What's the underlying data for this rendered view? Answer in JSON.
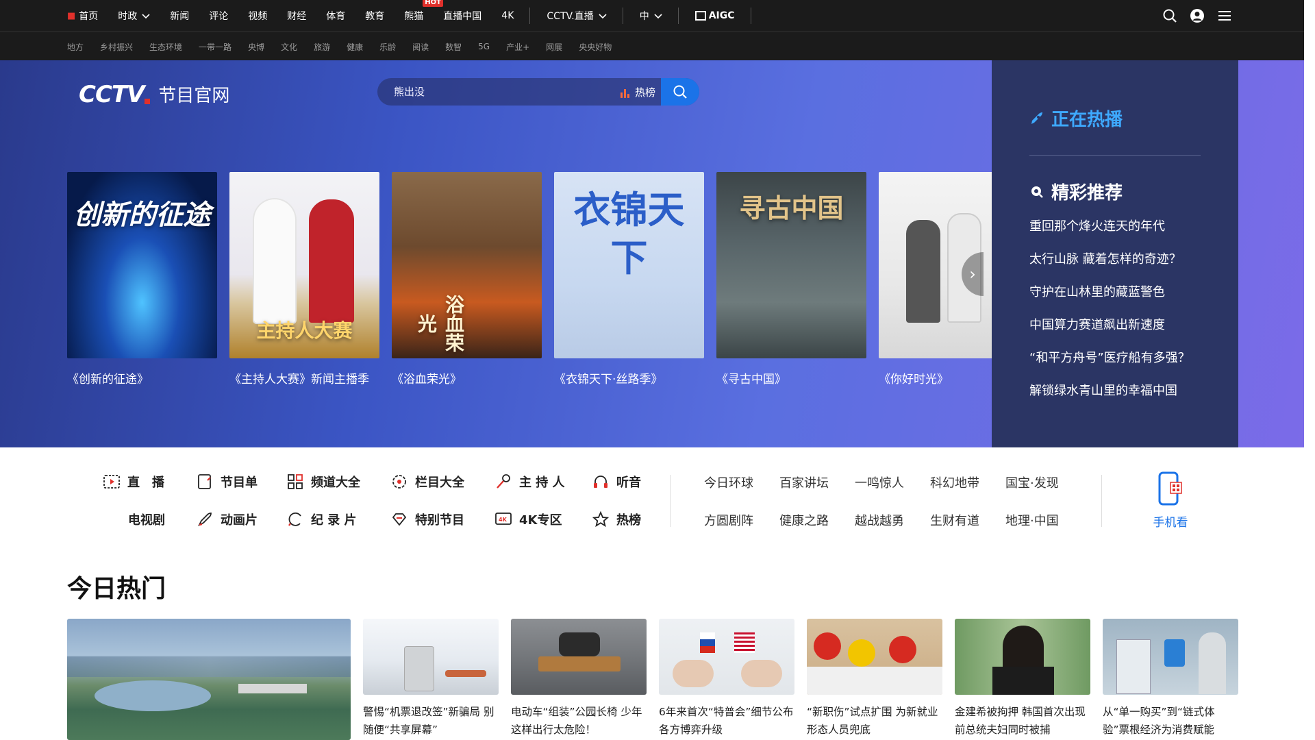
{
  "topnav": {
    "items": [
      {
        "label": "首页"
      },
      {
        "label": "时政"
      },
      {
        "label": "新闻"
      },
      {
        "label": "评论"
      },
      {
        "label": "视频"
      },
      {
        "label": "财经"
      },
      {
        "label": "体育"
      },
      {
        "label": "教育"
      },
      {
        "label": "熊猫",
        "badge": "HOT"
      },
      {
        "label": "直播中国"
      },
      {
        "label": "4K"
      }
    ],
    "live_label": "CCTV.直播",
    "lang_label": "中",
    "aigc_label": "AIGC"
  },
  "subnav": [
    "地方",
    "乡村振兴",
    "生态环境",
    "一带一路",
    "央博",
    "文化",
    "旅游",
    "健康",
    "乐龄",
    "阅读",
    "数智",
    "5G",
    "产业+",
    "网展",
    "央央好物"
  ],
  "hero": {
    "logo_text": "CCTV",
    "site_name": "节目官网",
    "search_placeholder": "熊出没",
    "rank_label": "热榜",
    "cards": [
      {
        "caption": "《创新的征途》",
        "poster_title": "创新的征途"
      },
      {
        "caption": "《主持人大赛》新闻主播季",
        "poster_title": "主持人大赛"
      },
      {
        "caption": "《浴血荣光》",
        "poster_title": "浴血荣光"
      },
      {
        "caption": "《衣锦天下·丝路季》",
        "poster_title": "衣锦天下"
      },
      {
        "caption": "《寻古中国》",
        "poster_title": "寻古中国"
      },
      {
        "caption": "《你好时光》",
        "poster_title": ""
      }
    ],
    "panel": {
      "hot_now": "正在热播",
      "recommend": "精彩推荐",
      "list": [
        "重回那个烽火连天的年代",
        "太行山脉 藏着怎样的奇迹？",
        "守护在山林里的藏蓝警色",
        "中国算力赛道飙出新速度",
        "“和平方舟号”医疗船有多强？",
        "解锁绿水青山里的幸福中国"
      ]
    }
  },
  "shortcuts": {
    "row1": [
      {
        "label": "直　播",
        "icon": "live-tv-icon"
      },
      {
        "label": "节目单",
        "icon": "schedule-icon"
      },
      {
        "label": "频道大全",
        "icon": "channels-icon"
      },
      {
        "label": "栏目大全",
        "icon": "columns-icon"
      },
      {
        "label": "主 持 人",
        "icon": "host-mic-icon"
      },
      {
        "label": "听音",
        "icon": "headphones-icon"
      }
    ],
    "row2": [
      {
        "label": "电视剧",
        "icon": ""
      },
      {
        "label": "动画片",
        "icon": "rocket-icon"
      },
      {
        "label": "纪 录 片",
        "icon": "documentary-icon"
      },
      {
        "label": "特别节目",
        "icon": "diamond-icon"
      },
      {
        "label": "4K专区",
        "icon": "4k-icon"
      },
      {
        "label": "热榜",
        "icon": "star-icon"
      }
    ],
    "programs_row1": [
      "今日环球",
      "百家讲坛",
      "一鸣惊人",
      "科幻地带",
      "国宝·发现"
    ],
    "programs_row2": [
      "方圆剧阵",
      "健康之路",
      "越战越勇",
      "生财有道",
      "地理·中国"
    ],
    "mobile_label": "手机看"
  },
  "today_hot": {
    "title": "今日热门",
    "news": [
      {
        "title": "警惕“机票退改签”新骗局 别随便“共享屏幕”"
      },
      {
        "title": "电动车“组装”公园长椅 少年这样出行太危险！"
      },
      {
        "title": "6年来首次“特普会”细节公布 各方博弈升级"
      },
      {
        "title": "“新职伤”试点扩围 为新就业形态人员兜底"
      },
      {
        "title": "金建希被拘押 韩国首次出现前总统夫妇同时被捕"
      },
      {
        "title": "从“单一购买”到“链式体验”票根经济为消费赋能"
      }
    ]
  },
  "colors": {
    "nav_bg": "#1b1b1b",
    "accent_red": "#e0302b",
    "accent_blue": "#1b73e8",
    "panel_title_blue": "#3ea9ff"
  }
}
